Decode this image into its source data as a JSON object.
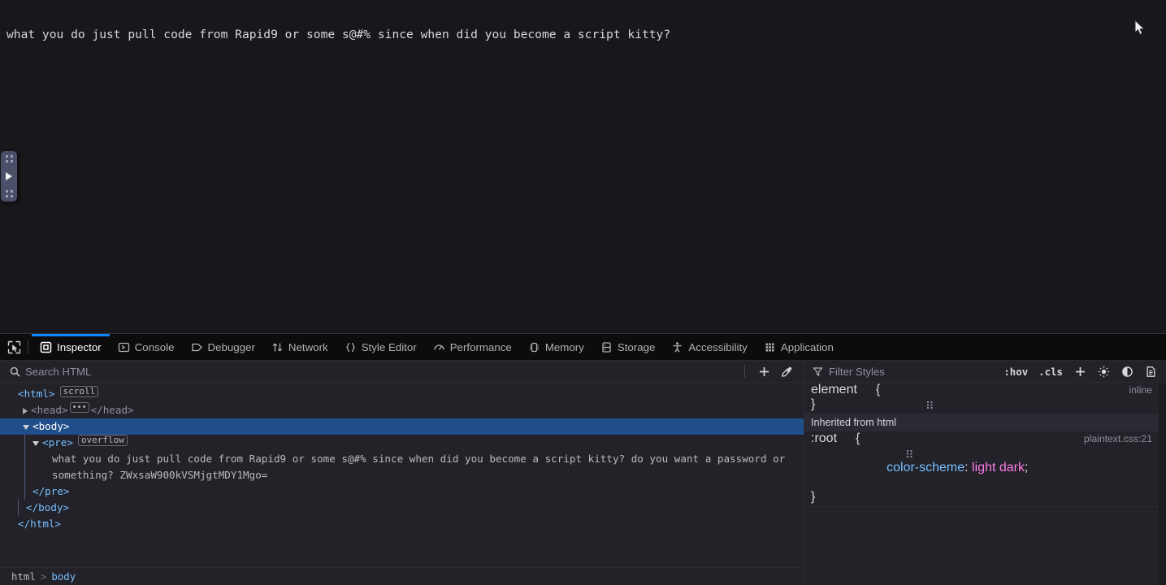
{
  "page": {
    "content_line": "what you do just pull code from Rapid9 or some s@#% since when did you become a script kitty?"
  },
  "handle": {
    "name": "resize-handle",
    "glyph": "▶"
  },
  "devtools": {
    "picker_icon": "element-picker-icon",
    "tabs": [
      {
        "label": "Inspector",
        "icon": "inspector-icon",
        "active": true
      },
      {
        "label": "Console",
        "icon": "console-icon",
        "active": false
      },
      {
        "label": "Debugger",
        "icon": "debugger-icon",
        "active": false
      },
      {
        "label": "Network",
        "icon": "network-icon",
        "active": false
      },
      {
        "label": "Style Editor",
        "icon": "style-editor-icon",
        "active": false
      },
      {
        "label": "Performance",
        "icon": "performance-icon",
        "active": false
      },
      {
        "label": "Memory",
        "icon": "memory-icon",
        "active": false
      },
      {
        "label": "Storage",
        "icon": "storage-icon",
        "active": false
      },
      {
        "label": "Accessibility",
        "icon": "accessibility-icon",
        "active": false
      },
      {
        "label": "Application",
        "icon": "application-icon",
        "active": false
      }
    ],
    "active_tab_accent": "#0a84ff",
    "selection_color": "#204e8a"
  },
  "search": {
    "placeholder": "Search HTML",
    "icon": "search-icon",
    "add_node_icon": "plus-icon",
    "eyedropper_icon": "eyedropper-icon"
  },
  "dom": {
    "nodes": {
      "html_open": "<html>",
      "html_badge": "scroll",
      "head_open": "<head>",
      "head_close": "</head>",
      "body_open": "<body>",
      "pre_open": "<pre>",
      "pre_badge": "overflow",
      "pre_text": "what you do just pull code from Rapid9 or some s@#% since when did you become a script kitty? do you want a password or something? ZWxsaW900kVSMjgtMDY1Mgo=",
      "pre_close": "</pre>",
      "body_close": "</body>",
      "html_close": "</html>"
    }
  },
  "breadcrumb": {
    "items": [
      "html",
      "body"
    ],
    "separator": ">"
  },
  "styles": {
    "filter_placeholder": "Filter Styles",
    "filter_icon": "filter-icon",
    "hov_label": ":hov",
    "cls_label": ".cls",
    "add_rule_icon": "plus-icon",
    "light_scheme_icon": "sun-icon",
    "dark_scheme_icon": "moon-icon",
    "print_icon": "print-media-icon",
    "rules": [
      {
        "selector": "element",
        "source": "inline",
        "declarations": []
      },
      {
        "inherited_label": "Inherited from html"
      },
      {
        "selector": ":root",
        "source": "plaintext.css:21",
        "declarations": [
          {
            "property": "color-scheme",
            "value": "light dark"
          }
        ]
      }
    ]
  }
}
